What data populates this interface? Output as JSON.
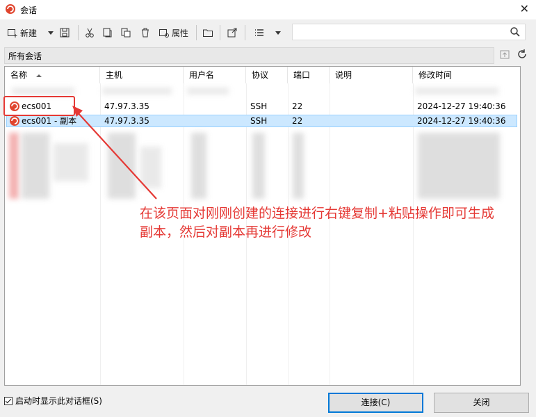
{
  "window": {
    "title": "会话",
    "close_glyph": "✕"
  },
  "toolbar": {
    "new_label": "新建",
    "properties_label": "属性",
    "search_placeholder": ""
  },
  "folder": {
    "path": "所有会话"
  },
  "table": {
    "columns": [
      "名称",
      "主机",
      "用户名",
      "协议",
      "端口",
      "说明",
      "修改时间"
    ],
    "rows": [
      {
        "name": "ecs001",
        "host": "47.97.3.35",
        "user": "",
        "protocol": "SSH",
        "port": "22",
        "desc": "",
        "modified": "2024-12-27 19:40:36",
        "selected": false
      },
      {
        "name": "ecs001 - 副本",
        "host": "47.97.3.35",
        "user": "",
        "protocol": "SSH",
        "port": "22",
        "desc": "",
        "modified": "2024-12-27 19:40:36",
        "selected": true
      }
    ]
  },
  "annotation": {
    "text_line1": "在该页面对刚刚创建的连接进行右键复制+粘贴操作即可生成",
    "text_line2": "副本，然后对副本再进行修改",
    "color": "#e53935"
  },
  "footer": {
    "show_on_start_label": "启动时显示此对话框(S)",
    "show_on_start_checked": true,
    "connect_label": "连接(C)",
    "close_label": "关闭"
  },
  "colors": {
    "accent": "#0078d7",
    "selection": "#cce8ff",
    "brand": "#e0452e"
  }
}
